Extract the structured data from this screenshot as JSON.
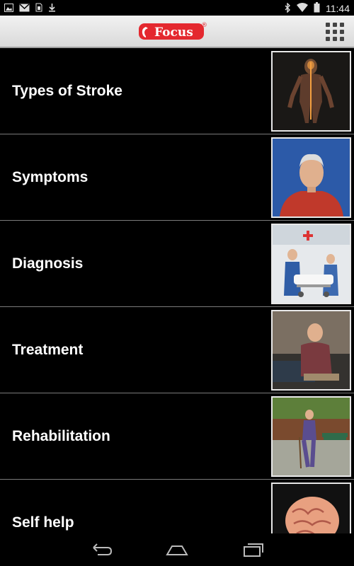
{
  "status_bar": {
    "time": "11:44",
    "icons": [
      "image-icon",
      "gmail-icon",
      "sim-icon",
      "download-icon",
      "bluetooth-icon",
      "wifi-icon",
      "battery-icon"
    ]
  },
  "app_bar": {
    "logo_text": "Focus",
    "registered_mark": "®",
    "menu_icon": "grid-menu-icon"
  },
  "topics": [
    {
      "label": "Types of Stroke",
      "thumbnail": "body-nervous-system-illustration"
    },
    {
      "label": "Symptoms",
      "thumbnail": "elderly-man-portrait"
    },
    {
      "label": "Diagnosis",
      "thumbnail": "hospital-stretcher-scene"
    },
    {
      "label": "Treatment",
      "thumbnail": "man-sitting-on-bed"
    },
    {
      "label": "Rehabilitation",
      "thumbnail": "man-walking-with-cane-in-park"
    },
    {
      "label": "Self help",
      "thumbnail": "brain-illustration"
    }
  ],
  "nav_bar": {
    "icons": [
      "back-icon",
      "home-icon",
      "recents-icon"
    ]
  },
  "colors": {
    "logo_red": "#e4282f",
    "list_background": "#000000",
    "divider": "#7a7a7a"
  }
}
